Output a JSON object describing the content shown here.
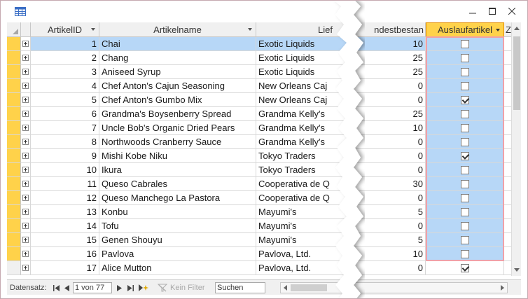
{
  "columns": {
    "artikelid": "ArtikelID",
    "artikelname": "Artikelname",
    "lieferant": "Lief",
    "mindestbestand": "ndestbestan",
    "auslaufartikel": "Auslaufartikel",
    "next": "Z"
  },
  "rows": [
    {
      "id": "1",
      "name": "Chai",
      "supplier": "Exotic Liquids",
      "min": "10",
      "discontinued": false,
      "selected": true
    },
    {
      "id": "2",
      "name": "Chang",
      "supplier": "Exotic Liquids",
      "min": "25",
      "discontinued": false
    },
    {
      "id": "3",
      "name": "Aniseed Syrup",
      "supplier": "Exotic Liquids",
      "min": "25",
      "discontinued": false
    },
    {
      "id": "4",
      "name": "Chef Anton's Cajun Seasoning",
      "supplier": "New Orleans Caj",
      "min": "0",
      "discontinued": false
    },
    {
      "id": "5",
      "name": "Chef Anton's Gumbo Mix",
      "supplier": "New Orleans Caj",
      "min": "0",
      "discontinued": true
    },
    {
      "id": "6",
      "name": "Grandma's Boysenberry Spread",
      "supplier": "Grandma Kelly's",
      "min": "25",
      "discontinued": false
    },
    {
      "id": "7",
      "name": "Uncle Bob's Organic Dried Pears",
      "supplier": "Grandma Kelly's",
      "min": "10",
      "discontinued": false
    },
    {
      "id": "8",
      "name": "Northwoods Cranberry Sauce",
      "supplier": "Grandma Kelly's",
      "min": "0",
      "discontinued": false
    },
    {
      "id": "9",
      "name": "Mishi Kobe Niku",
      "supplier": "Tokyo Traders",
      "min": "0",
      "discontinued": true
    },
    {
      "id": "10",
      "name": "Ikura",
      "supplier": "Tokyo Traders",
      "min": "0",
      "discontinued": false
    },
    {
      "id": "11",
      "name": "Queso Cabrales",
      "supplier": "Cooperativa de Q",
      "min": "30",
      "discontinued": false
    },
    {
      "id": "12",
      "name": "Queso Manchego La Pastora",
      "supplier": "Cooperativa de Q",
      "min": "0",
      "discontinued": false
    },
    {
      "id": "13",
      "name": "Konbu",
      "supplier": "Mayumi's",
      "min": "5",
      "discontinued": false
    },
    {
      "id": "14",
      "name": "Tofu",
      "supplier": "Mayumi's",
      "min": "0",
      "discontinued": false
    },
    {
      "id": "15",
      "name": "Genen Shouyu",
      "supplier": "Mayumi's",
      "min": "5",
      "discontinued": false
    },
    {
      "id": "16",
      "name": "Pavlova",
      "supplier": "Pavlova, Ltd.",
      "min": "10",
      "discontinued": false
    },
    {
      "id": "17",
      "name": "Alice Mutton",
      "supplier": "Pavlova, Ltd.",
      "min": "0",
      "discontinued": true
    }
  ],
  "navigation": {
    "label": "Datensatz:",
    "position": "1 von 77",
    "filter_label": "Kein Filter",
    "search_placeholder": "Suchen"
  },
  "colors": {
    "row_selector": "#ffd24a",
    "selected_row": "#b7d7f7",
    "column_selection": "#b7d7f7",
    "active_header": "#ffd24a",
    "selection_border": "#f0a0a8"
  }
}
